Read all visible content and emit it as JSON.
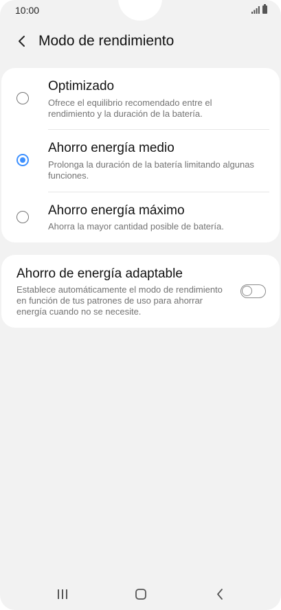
{
  "status_bar": {
    "time": "10:00",
    "icons": [
      "signal-icon",
      "battery-icon"
    ]
  },
  "header": {
    "back_icon": "chevron-left-icon",
    "title": "Modo de rendimiento"
  },
  "modes": [
    {
      "title": "Optimizado",
      "description": "Ofrece el equilibrio recomendado entre el rendimiento y la duración de la batería.",
      "selected": false
    },
    {
      "title": "Ahorro energía medio",
      "description": "Prolonga la duración de la batería limitando algunas funciones.",
      "selected": true
    },
    {
      "title": "Ahorro energía máximo",
      "description": "Ahorra la mayor cantidad posible de batería.",
      "selected": false
    }
  ],
  "adaptive": {
    "title": "Ahorro de energía adaptable",
    "description": "Establece automáticamente el modo de rendimiento en función de tus patrones de uso para ahorrar energía cuando no se necesite.",
    "enabled": false
  },
  "nav_bar": {
    "icons": [
      "recents-icon",
      "home-icon",
      "back-icon"
    ]
  },
  "colors": {
    "accent": "#3e91ff",
    "background": "#f2f2f2",
    "card": "#ffffff"
  }
}
